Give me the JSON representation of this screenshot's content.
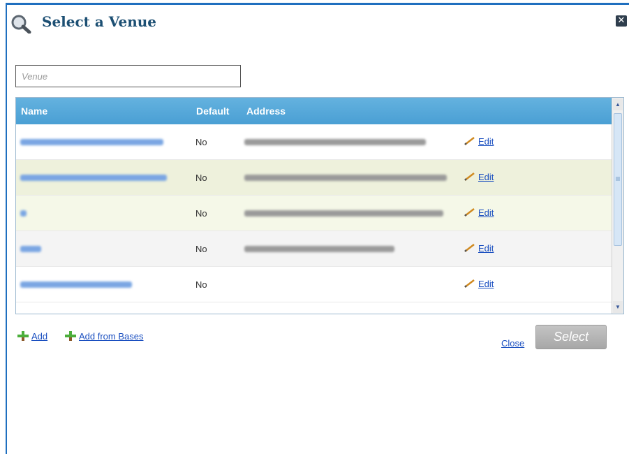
{
  "dialog": {
    "title": "Select a Venue",
    "close_icon": "close-x-icon",
    "title_icon": "magnifier-icon"
  },
  "search": {
    "placeholder": "Venue",
    "value": ""
  },
  "grid": {
    "columns": [
      "Name",
      "Default",
      "Address",
      ""
    ],
    "rows": [
      {
        "name": "",
        "default": "No",
        "address": "",
        "action": "Edit",
        "redacted_name": true,
        "redacted_address": true
      },
      {
        "name": "",
        "default": "No",
        "address": "",
        "action": "Edit",
        "redacted_name": true,
        "redacted_address": true
      },
      {
        "name": "",
        "default": "No",
        "address": "",
        "action": "Edit",
        "redacted_name": true,
        "redacted_address": true
      },
      {
        "name": "",
        "default": "No",
        "address": "",
        "action": "Edit",
        "redacted_name": true,
        "redacted_address": true
      },
      {
        "name": "",
        "default": "No",
        "address": "",
        "action": "Edit",
        "redacted_name": true,
        "redacted_address": false
      }
    ]
  },
  "footer": {
    "add_label": "Add",
    "add_from_bases_label": "Add from Bases",
    "close_label": "Close",
    "select_label": "Select"
  },
  "colors": {
    "header_blue": "#4a9fd4",
    "title_color": "#1c4f73",
    "link_color": "#1a4fc0",
    "row_highlight": "#eef1dc",
    "select_disabled": "#b5b5b5"
  }
}
